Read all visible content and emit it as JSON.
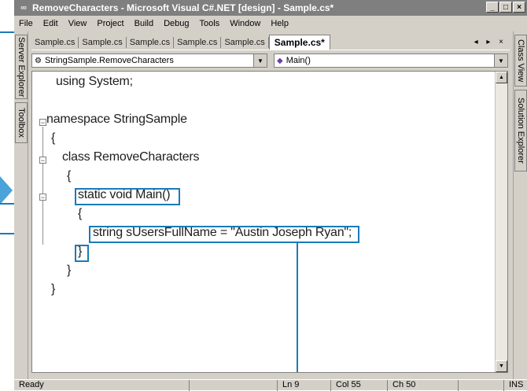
{
  "title_bar": {
    "title": "RemoveCharacters - Microsoft Visual C#.NET [design] - Sample.cs*",
    "icon": "visual-studio-icon",
    "min": "_",
    "restore": "□",
    "close": "×"
  },
  "menu": {
    "items": [
      "File",
      "Edit",
      "View",
      "Project",
      "Build",
      "Debug",
      "Tools",
      "Window",
      "Help"
    ]
  },
  "side_tabs": {
    "left": [
      "Server Explorer",
      "Toolbox"
    ],
    "right": [
      "Class View",
      "Solution Explorer"
    ]
  },
  "doc_tabs": {
    "items": [
      "Sample.cs",
      "Sample.cs",
      "Sample.cs",
      "Sample.cs",
      "Sample.cs"
    ],
    "active": "Sample.cs*",
    "nav": "◂ ▸ ×"
  },
  "dropdowns": {
    "class_selector": "StringSample.RemoveCharacters",
    "member_selector": "Main()"
  },
  "code": {
    "lines": [
      "using System;",
      "namespace StringSample",
      "{",
      "class RemoveCharacters",
      "{",
      "static void Main()",
      "{",
      "string sUsersFullName = \"Austin Joseph Ryan\";",
      "}",
      "}",
      "}"
    ]
  },
  "status": {
    "ready": "Ready",
    "line": "Ln 9",
    "col": "Col 55",
    "ch": "Ch 50",
    "ins": "INS"
  },
  "colors": {
    "callout": "#1a7bb8",
    "title_bg": "#7f7f7f",
    "chrome": "#d4d0c8"
  }
}
